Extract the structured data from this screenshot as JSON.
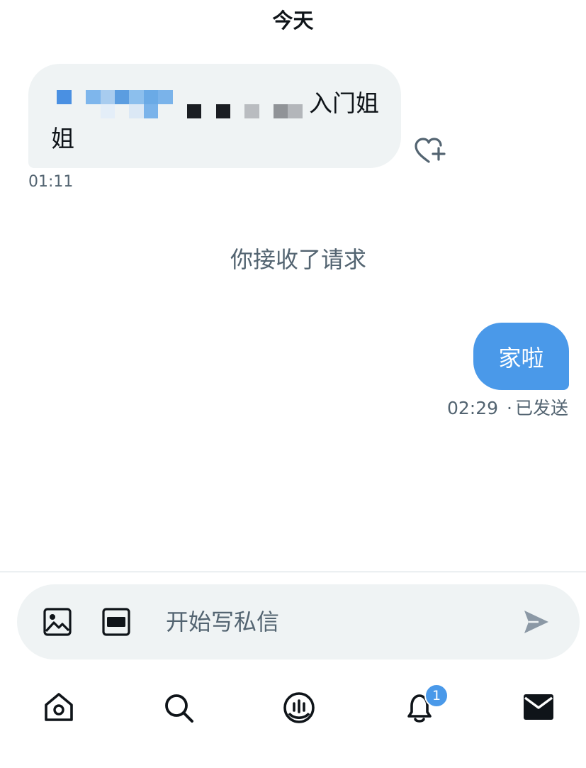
{
  "header": {
    "date_label": "今天"
  },
  "messages": [
    {
      "direction": "incoming",
      "text_line1_visible": "入门姐",
      "text_line2": "姐",
      "time": "01:11"
    },
    {
      "direction": "system",
      "text": "你接收了请求"
    },
    {
      "direction": "outgoing",
      "text": "家啦",
      "time": "02:29",
      "status": "已发送",
      "separator": "·"
    }
  ],
  "composer": {
    "placeholder": "开始写私信",
    "icons": [
      "image-icon",
      "gif-icon",
      "send-icon"
    ]
  },
  "bottom_nav": {
    "items": [
      "home-icon",
      "search-icon",
      "spaces-icon",
      "notifications-icon",
      "messages-icon"
    ],
    "notifications_badge": "1"
  },
  "colors": {
    "accent": "#4a99e9",
    "bubble_in": "#eff3f4",
    "text_primary": "#0f1419",
    "text_secondary": "#536471"
  }
}
